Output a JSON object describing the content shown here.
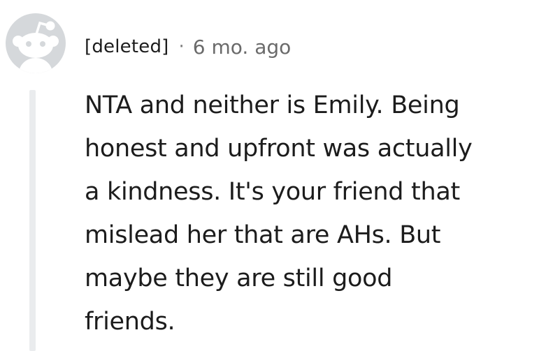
{
  "comment": {
    "author": "[deleted]",
    "separator": "·",
    "timestamp": "6 mo. ago",
    "avatar_icon": "snoo-default-avatar-icon",
    "body_lines": [
      "NTA and neither is Emily. Being",
      "honest and upfront was actually",
      "a kindness. It's your friend that",
      "mislead her that are AHs. But",
      "maybe they are still good",
      "friends."
    ]
  },
  "colors": {
    "avatar_bg": "#d5d8db",
    "avatar_fg": "#ffffff",
    "thread_line": "#eaecee",
    "text": "#1c1c1c",
    "meta": "#6a6a6a"
  }
}
